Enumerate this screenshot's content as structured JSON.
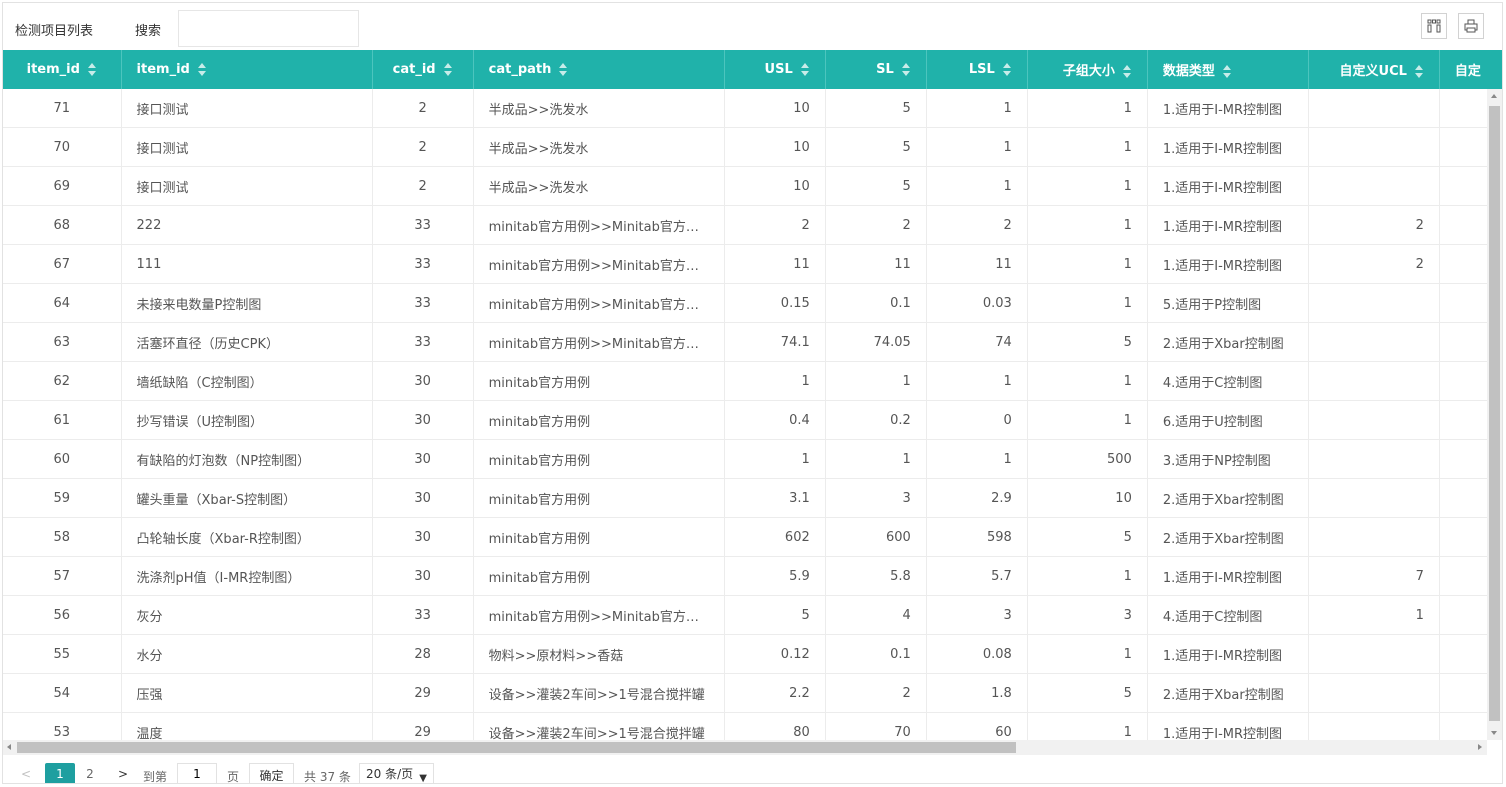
{
  "header": {
    "title": "检测项目列表",
    "search_label": "搜索",
    "search_value": "",
    "columns_icon": "columns-icon",
    "export_icon": "print-icon"
  },
  "table": {
    "columns": [
      "item_id",
      "item_id",
      "cat_id",
      "cat_path",
      "USL",
      "SL",
      "LSL",
      "子组大小",
      "数据类型",
      "自定义UCL",
      "自定"
    ],
    "rows": [
      [
        "71",
        "接口测试",
        "2",
        "半成品>>洗发水",
        "10",
        "5",
        "1",
        "1",
        "1.适用于I-MR控制图",
        ""
      ],
      [
        "70",
        "接口测试",
        "2",
        "半成品>>洗发水",
        "10",
        "5",
        "1",
        "1",
        "1.适用于I-MR控制图",
        ""
      ],
      [
        "69",
        "接口测试",
        "2",
        "半成品>>洗发水",
        "10",
        "5",
        "1",
        "1",
        "1.适用于I-MR控制图",
        ""
      ],
      [
        "68",
        "222",
        "33",
        "minitab官方用例>>Minitab官方案例…",
        "2",
        "2",
        "2",
        "1",
        "1.适用于I-MR控制图",
        "2"
      ],
      [
        "67",
        "111",
        "33",
        "minitab官方用例>>Minitab官方案例…",
        "11",
        "11",
        "11",
        "1",
        "1.适用于I-MR控制图",
        "2"
      ],
      [
        "64",
        "未接来电数量P控制图",
        "33",
        "minitab官方用例>>Minitab官方案例…",
        "0.15",
        "0.1",
        "0.03",
        "1",
        "5.适用于P控制图",
        ""
      ],
      [
        "63",
        "活塞环直径（历史CPK）",
        "33",
        "minitab官方用例>>Minitab官方案例…",
        "74.1",
        "74.05",
        "74",
        "5",
        "2.适用于Xbar控制图",
        ""
      ],
      [
        "62",
        "墙纸缺陷（C控制图）",
        "30",
        "minitab官方用例",
        "1",
        "1",
        "1",
        "1",
        "4.适用于C控制图",
        ""
      ],
      [
        "61",
        "抄写错误（U控制图）",
        "30",
        "minitab官方用例",
        "0.4",
        "0.2",
        "0",
        "1",
        "6.适用于U控制图",
        ""
      ],
      [
        "60",
        "有缺陷的灯泡数（NP控制图）",
        "30",
        "minitab官方用例",
        "1",
        "1",
        "1",
        "500",
        "3.适用于NP控制图",
        ""
      ],
      [
        "59",
        "罐头重量（Xbar-S控制图）",
        "30",
        "minitab官方用例",
        "3.1",
        "3",
        "2.9",
        "10",
        "2.适用于Xbar控制图",
        ""
      ],
      [
        "58",
        "凸轮轴长度（Xbar-R控制图）",
        "30",
        "minitab官方用例",
        "602",
        "600",
        "598",
        "5",
        "2.适用于Xbar控制图",
        ""
      ],
      [
        "57",
        "洗涤剂pH值（I-MR控制图）",
        "30",
        "minitab官方用例",
        "5.9",
        "5.8",
        "5.7",
        "1",
        "1.适用于I-MR控制图",
        "7"
      ],
      [
        "56",
        "灰分",
        "33",
        "minitab官方用例>>Minitab官方案例…",
        "5",
        "4",
        "3",
        "3",
        "4.适用于C控制图",
        "1"
      ],
      [
        "55",
        "水分",
        "28",
        "物料>>原材料>>香菇",
        "0.12",
        "0.1",
        "0.08",
        "1",
        "1.适用于I-MR控制图",
        ""
      ],
      [
        "54",
        "压强",
        "29",
        "设备>>灌装2车间>>1号混合搅拌罐",
        "2.2",
        "2",
        "1.8",
        "5",
        "2.适用于Xbar控制图",
        ""
      ],
      [
        "53",
        "温度",
        "29",
        "设备>>灌装2车间>>1号混合搅拌罐",
        "80",
        "70",
        "60",
        "1",
        "1.适用于I-MR控制图",
        ""
      ]
    ]
  },
  "pager": {
    "prev": "<",
    "pages": [
      "1",
      "2"
    ],
    "next": ">",
    "goto_label": "到第",
    "goto_value": "1",
    "page_unit": "页",
    "ok_label": "确定",
    "total": "共 37 条",
    "page_size": "20 条/页"
  }
}
